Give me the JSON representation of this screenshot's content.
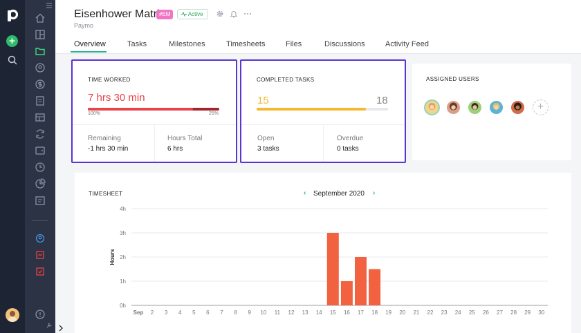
{
  "app": {
    "title": "Eisenhower Matrix",
    "code_badge": "#EM",
    "status_badge": "Active",
    "subtitle": "Paymo"
  },
  "tabs": [
    {
      "label": "Overview",
      "active": true
    },
    {
      "label": "Tasks"
    },
    {
      "label": "Milestones"
    },
    {
      "label": "Timesheets"
    },
    {
      "label": "Files"
    },
    {
      "label": "Discussions"
    },
    {
      "label": "Activity Feed"
    }
  ],
  "time_worked": {
    "label": "TIME WORKED",
    "value": "7 hrs 30 min",
    "progress_percent": 125,
    "left_tick": "100%",
    "right_tick": "25%",
    "remaining_label": "Remaining",
    "remaining_value": "-1 hrs 30 min",
    "total_label": "Hours Total",
    "total_value": "6 hrs",
    "color": "#e8424a"
  },
  "completed_tasks": {
    "label": "COMPLETED TASKS",
    "completed": "15",
    "total": "18",
    "progress_fraction": 0.83,
    "open_label": "Open",
    "open_value": "3 tasks",
    "overdue_label": "Overdue",
    "overdue_value": "0 tasks",
    "color": "#f5b82e"
  },
  "assigned_users": {
    "label": "ASSIGNED USERS",
    "count": 5
  },
  "timesheet": {
    "label": "TIMESHEET",
    "month": "September 2020"
  },
  "chart_data": {
    "type": "bar",
    "ylabel": "Hours",
    "ytick_labels": [
      "0h",
      "1h",
      "2h",
      "3h",
      "4h"
    ],
    "ylim": [
      0,
      4
    ],
    "month_label": "Sep",
    "categories": [
      "1",
      "2",
      "3",
      "4",
      "5",
      "6",
      "7",
      "8",
      "9",
      "10",
      "11",
      "12",
      "13",
      "14",
      "15",
      "16",
      "17",
      "18",
      "19",
      "20",
      "21",
      "22",
      "23",
      "24",
      "25",
      "26",
      "27",
      "28",
      "29",
      "30"
    ],
    "values": [
      0,
      0,
      0,
      0,
      0,
      0,
      0,
      0,
      0,
      0,
      0,
      0,
      0,
      0,
      3,
      1,
      2,
      1.5,
      0,
      0,
      0,
      0,
      0,
      0,
      0,
      0,
      0,
      0,
      0,
      0
    ],
    "bar_color": "#f26140",
    "grid": true
  }
}
